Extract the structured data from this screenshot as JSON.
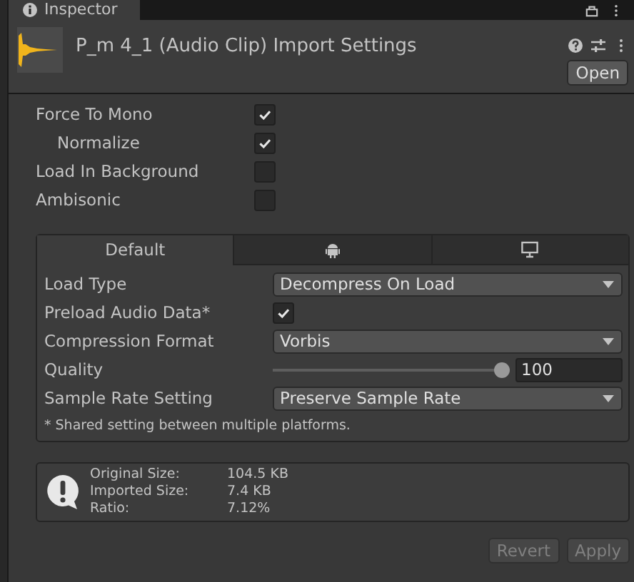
{
  "window": {
    "tab": "Inspector"
  },
  "header": {
    "title": "P_m 4_1 (Audio Clip) Import Settings",
    "open_button": "Open"
  },
  "options": [
    {
      "label": "Force To Mono",
      "checked": true,
      "indented": false
    },
    {
      "label": "Normalize",
      "checked": true,
      "indented": true
    },
    {
      "label": "Load In Background",
      "checked": false,
      "indented": false
    },
    {
      "label": "Ambisonic",
      "checked": false,
      "indented": false
    }
  ],
  "platform_tabs": [
    {
      "kind": "text",
      "label": "Default",
      "selected": true
    },
    {
      "kind": "android",
      "selected": false
    },
    {
      "kind": "monitor",
      "selected": false
    }
  ],
  "settings": [
    {
      "kind": "dropdown",
      "label": "Load Type",
      "value": "Decompress On Load"
    },
    {
      "kind": "checkbox",
      "label": "Preload Audio Data*",
      "checked": true
    },
    {
      "kind": "dropdown",
      "label": "Compression Format",
      "value": "Vorbis"
    },
    {
      "kind": "slider",
      "label": "Quality",
      "level": 1,
      "value": "100"
    },
    {
      "kind": "dropdown",
      "label": "Sample Rate Setting",
      "value": "Preserve Sample Rate"
    }
  ],
  "note": "* Shared setting between multiple platforms.",
  "info": [
    {
      "label": "Original Size:",
      "value": "104.5 KB"
    },
    {
      "label": "Imported Size:",
      "value": "7.4 KB"
    },
    {
      "label": "Ratio:",
      "value": "7.12%"
    }
  ],
  "buttons": [
    {
      "label": "Revert",
      "disabled": true
    },
    {
      "label": "Apply",
      "disabled": true
    }
  ]
}
